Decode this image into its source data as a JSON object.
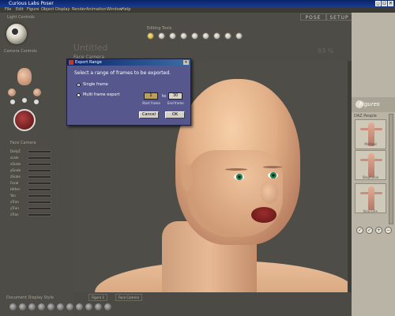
{
  "window": {
    "title": "Curious Labs Poser"
  },
  "menu": [
    "File",
    "Edit",
    "Figure",
    "Object",
    "Display",
    "Render",
    "Animation",
    "Window",
    "Help"
  ],
  "tabs": {
    "pose": "POSE",
    "setup": "SETUP"
  },
  "left": {
    "light_controls": "Light Controls",
    "camera_controls": "Camera Controls",
    "parameters_title": "Face Camera",
    "params": [
      {
        "label": "DollyZ"
      },
      {
        "label": "scale"
      },
      {
        "label": "xScale"
      },
      {
        "label": "yScale"
      },
      {
        "label": "zScale"
      },
      {
        "label": "Focal"
      },
      {
        "label": "Hither"
      },
      {
        "label": "Yon"
      },
      {
        "label": "xTran"
      },
      {
        "label": "yTran"
      },
      {
        "label": "zTran"
      }
    ]
  },
  "viewport": {
    "title": "Untitled",
    "camera": "Face Camera",
    "zoom": "93 %",
    "editing_tools_label": "Editing Tools"
  },
  "dialog": {
    "title": "Export Range",
    "message": "Select a range of frames to be exported.",
    "option_single": "Single frame",
    "option_multi": "Multi frame export",
    "to_label": "to",
    "start_value": "1",
    "end_value": "30",
    "start_label": "Start frame",
    "end_label": "End frame",
    "cancel": "Cancel",
    "ok": "OK",
    "close": "×"
  },
  "library": {
    "heading": "Figures",
    "category": "DAZ People",
    "items": [
      {
        "label": "Michael"
      },
      {
        "label": "Stephanie"
      },
      {
        "label": "Vicki LR+"
      }
    ]
  },
  "bottom": {
    "document_display_style": "Document Display Style",
    "tab1": "Figure 1",
    "tab2": "Face Camera"
  },
  "colors": {
    "accent_iris": "#1d9a5c",
    "dialog_bg": "#55578d",
    "titlebar": "#0a246a"
  }
}
